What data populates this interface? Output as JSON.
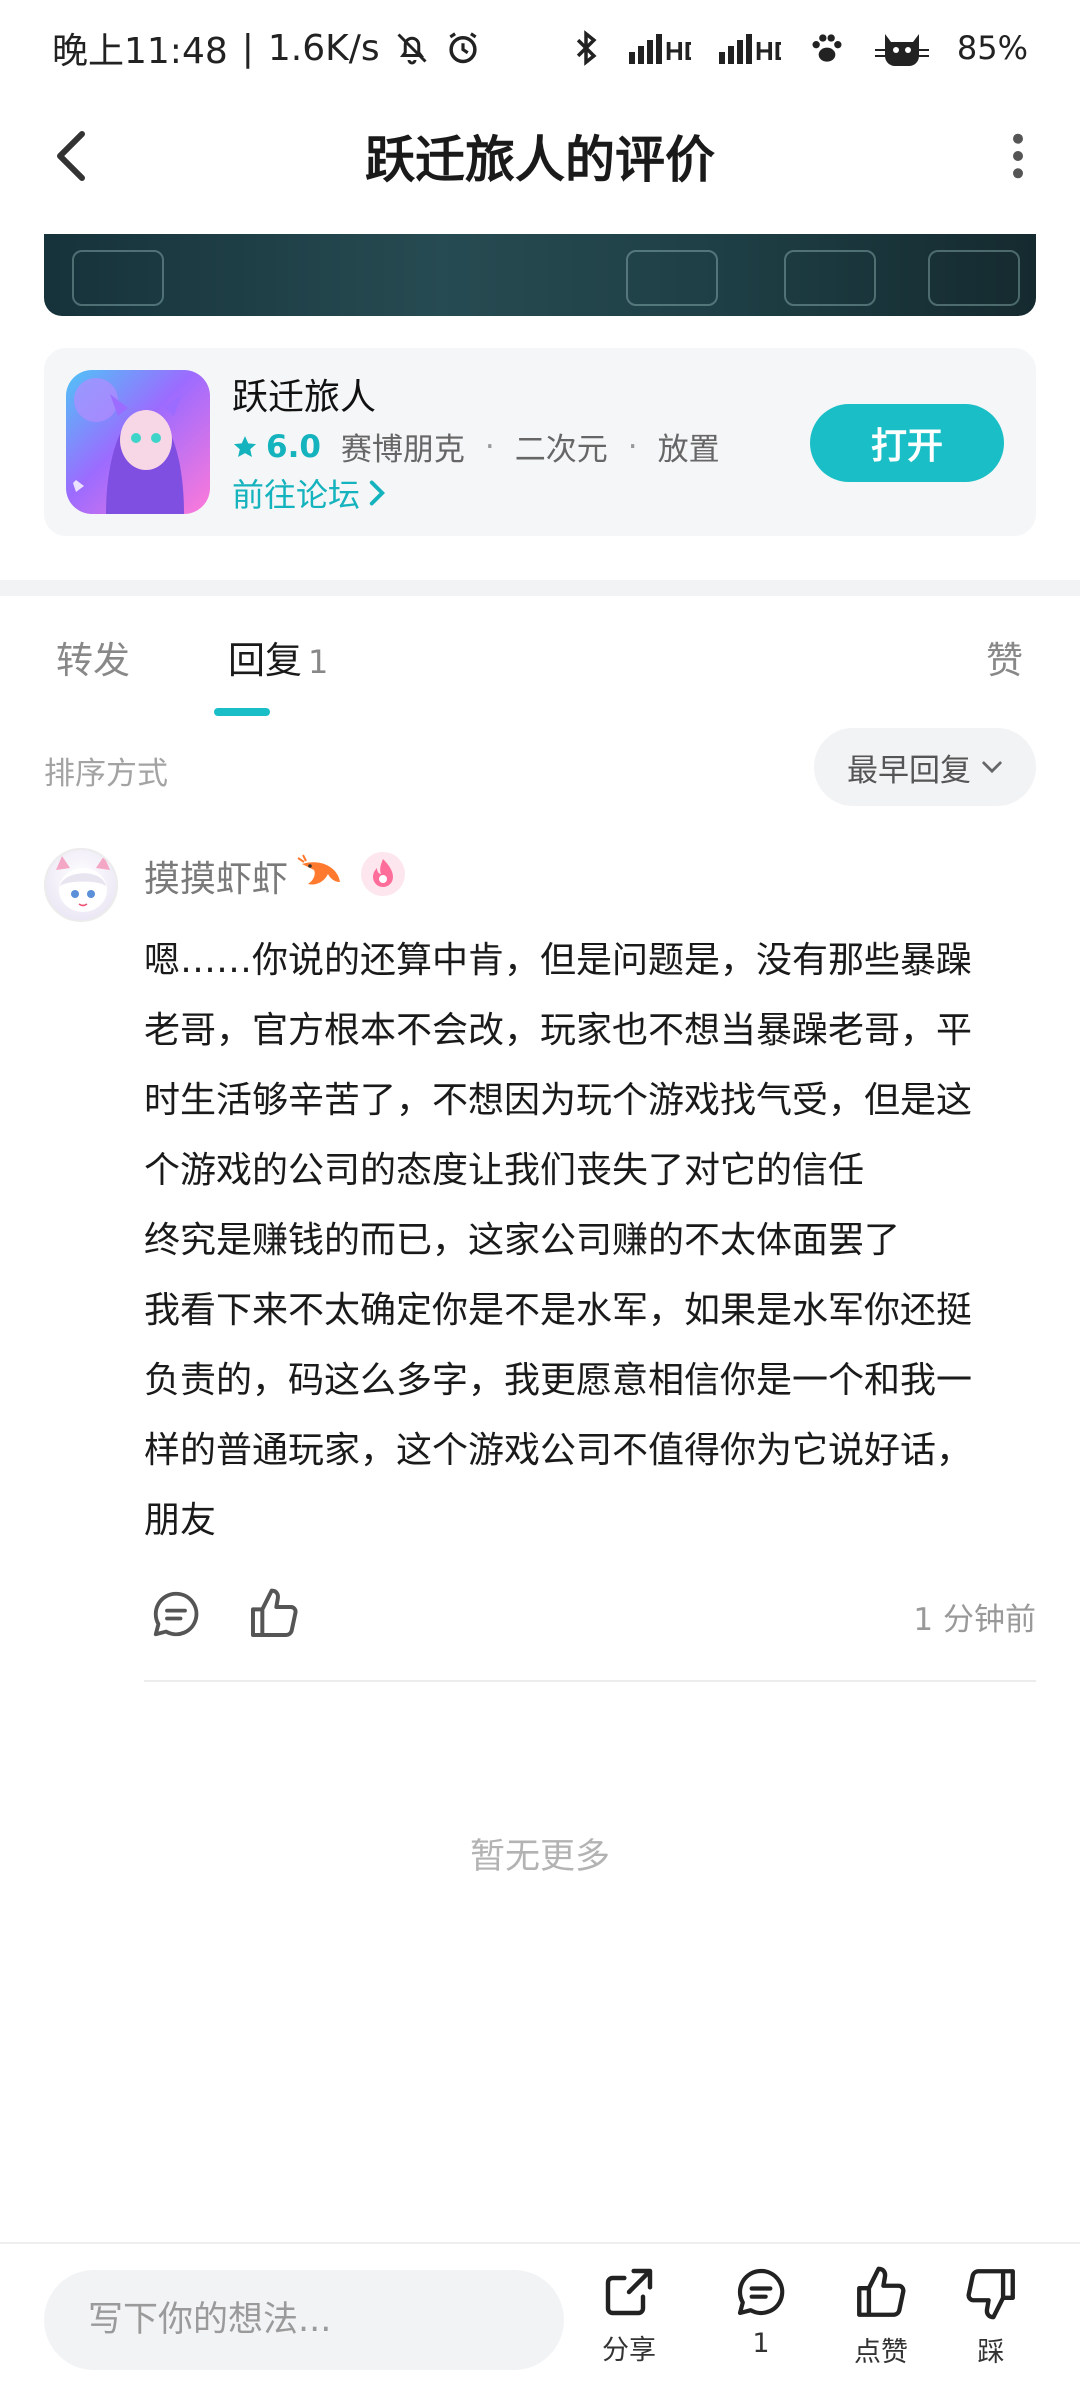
{
  "status_bar": {
    "time": "晚上11:48",
    "speed": "1.6K/s",
    "battery": "85%"
  },
  "header": {
    "title": "跃迁旅人的评价"
  },
  "game_card": {
    "name": "跃迁旅人",
    "rating": "6.0",
    "tags": [
      "赛博朋克",
      "二次元",
      "放置"
    ],
    "forum_link": "前往论坛",
    "open_button": "打开"
  },
  "tabs": [
    {
      "label": "转发"
    },
    {
      "label": "回复",
      "count": "1"
    },
    {
      "label": "赞"
    }
  ],
  "sort": {
    "label": "排序方式",
    "selected": "最早回复"
  },
  "comment": {
    "username": "摸摸虾虾",
    "lines": [
      "嗯……你说的还算中肯，但是问题是，没有那些暴躁",
      "老哥，官方根本不会改，玩家也不想当暴躁老哥，平",
      "时生活够辛苦了，不想因为玩个游戏找气受，但是这",
      "个游戏的公司的态度让我们丧失了对它的信任",
      "终究是赚钱的而已，这家公司赚的不太体面罢了",
      "我看下来不太确定你是不是水军，如果是水军你还挺",
      "负责的，码这么多字，我更愿意相信你是一个和我一",
      "样的普通玩家，这个游戏公司不值得你为它说好话，",
      "朋友"
    ],
    "time": "1 分钟前"
  },
  "no_more": "暂无更多",
  "bottom_bar": {
    "input_placeholder": "写下你的想法...",
    "share_label": "分享",
    "comment_count": "1",
    "like_label": "点赞",
    "dislike_label": "踩"
  },
  "colors": {
    "accent": "#19bec7",
    "accent_text": "#14b3bd"
  }
}
